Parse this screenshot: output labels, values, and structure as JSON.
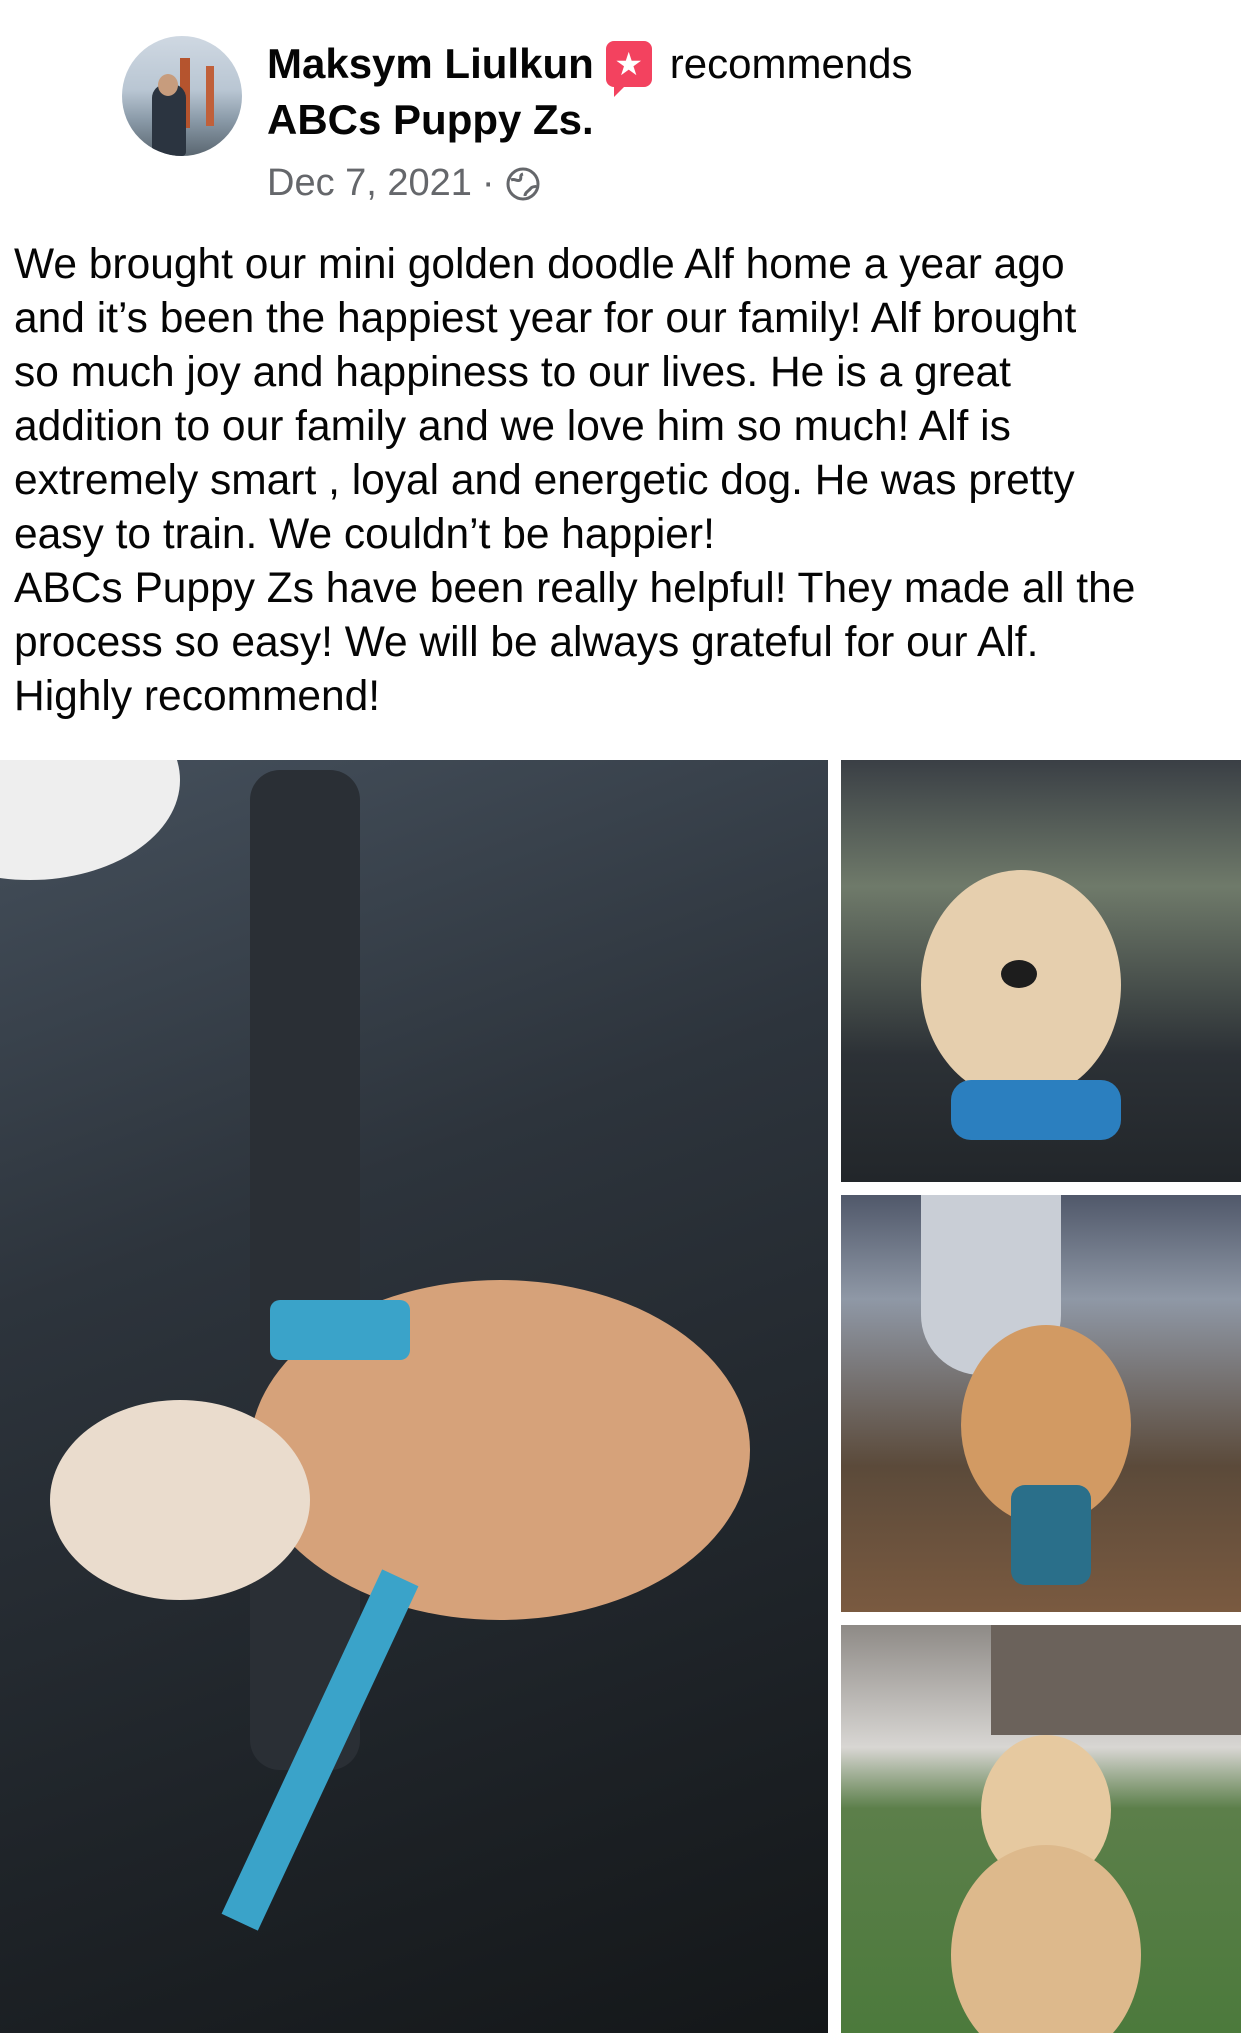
{
  "post": {
    "author": "Maksym Liulkun",
    "verb": "recommends",
    "page": "ABCs Puppy Zs.",
    "date": "Dec 7, 2021",
    "separator": "·",
    "text": "We brought our mini golden doodle Alf home a year ago\nand it’s been the happiest year for our family! Alf brought\nso much joy and happiness to our lives. He is a great\naddition to our family and we love him so much! Alf is\nextremely smart , loyal and energetic dog. He was pretty\neasy to train. We couldn’t be happier!\nABCs Puppy Zs have been really helpful! They made all the\nprocess so easy! We will be always grateful for our Alf.\nHighly recommend!"
  },
  "icons": {
    "recommend": "recommend-star-icon",
    "audience": "globe-icon",
    "star_glyph": "★"
  },
  "colors": {
    "recommend_badge": "#f3425f",
    "meta_text": "#65676b"
  }
}
